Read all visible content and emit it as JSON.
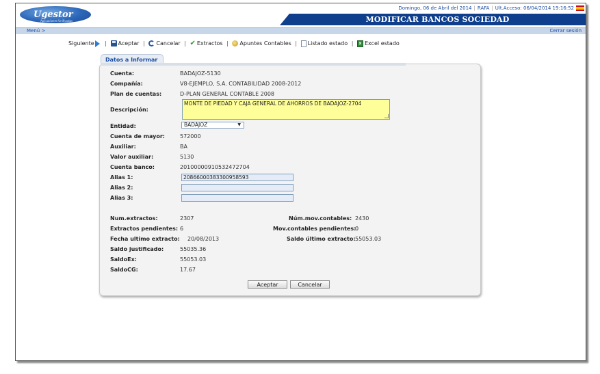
{
  "header": {
    "logo_text": "Ugestor",
    "logo_tagline": "Aplicaciones Unificadas",
    "date": "Domingo, 06 de Abril del 2014",
    "user": "RAFA",
    "last_access": "Ult.Acceso: 06/04/2014 19:16:52",
    "page_title": "MODIFICAR BANCOS SOCIEDAD"
  },
  "menubar": {
    "menu_label": "Menú >",
    "logout_label": "Cerrar sesión"
  },
  "toolbar": {
    "next": "Siguiente",
    "accept": "Aceptar",
    "cancel": "Cancelar",
    "extracts": "Extractos",
    "accounting_entries": "Apuntes Contables",
    "status_list": "Listado estado",
    "excel_status": "Excel estado"
  },
  "form": {
    "tab_label": "Datos a Informar",
    "cuenta": {
      "label": "Cuenta:",
      "value": "BADAJOZ-5130"
    },
    "compania": {
      "label": "Compañía:",
      "value": "V8-EJEMPLO, S.A. CONTABILIDAD 2008-2012"
    },
    "plan": {
      "label": "Plan de cuentas:",
      "value": "D-PLAN GENERAL CONTABLE 2008"
    },
    "descripcion": {
      "label": "Descripción:",
      "value": "MONTE DE PIEDAD Y CAJA GENERAL DE AHORROS DE BADAJOZ-2704"
    },
    "entidad": {
      "label": "Entidad:",
      "value": "BADAJOZ"
    },
    "cuenta_mayor": {
      "label": "Cuenta de mayor:",
      "value": "572000"
    },
    "auxiliar": {
      "label": "Auxiliar:",
      "value": "BA"
    },
    "valor_auxiliar": {
      "label": "Valor auxiliar:",
      "value": "5130"
    },
    "cuenta_banco": {
      "label": "Cuenta banco:",
      "value": "20100000910532472704"
    },
    "alias1": {
      "label": "Alias 1:",
      "value": "20866000383300958593"
    },
    "alias2": {
      "label": "Alias 2:",
      "value": ""
    },
    "alias3": {
      "label": "Alias 3:",
      "value": ""
    },
    "num_extractos": {
      "label": "Num.extractos:",
      "value": "2307"
    },
    "extractos_pendientes": {
      "label": "Extractos pendientes:",
      "value": "6"
    },
    "fecha_ultimo": {
      "label": "Fecha ultimo extracto:",
      "value": "20/08/2013"
    },
    "saldo_justificado": {
      "label": "Saldo justificado:",
      "value": "55035.36"
    },
    "saldo_ex": {
      "label": "SaldoEx:",
      "value": "55053.03"
    },
    "saldo_cg": {
      "label": "SaldoCG:",
      "value": "17.67"
    },
    "num_mov": {
      "label": "Núm.mov.contables:",
      "value": "2430"
    },
    "mov_pendientes": {
      "label": "Mov.contables pendientes:",
      "value": "0"
    },
    "saldo_ultimo": {
      "label": "Saldo último extracto:",
      "value": "55053.03"
    },
    "accept_button": "Aceptar",
    "cancel_button": "Cancelar"
  }
}
